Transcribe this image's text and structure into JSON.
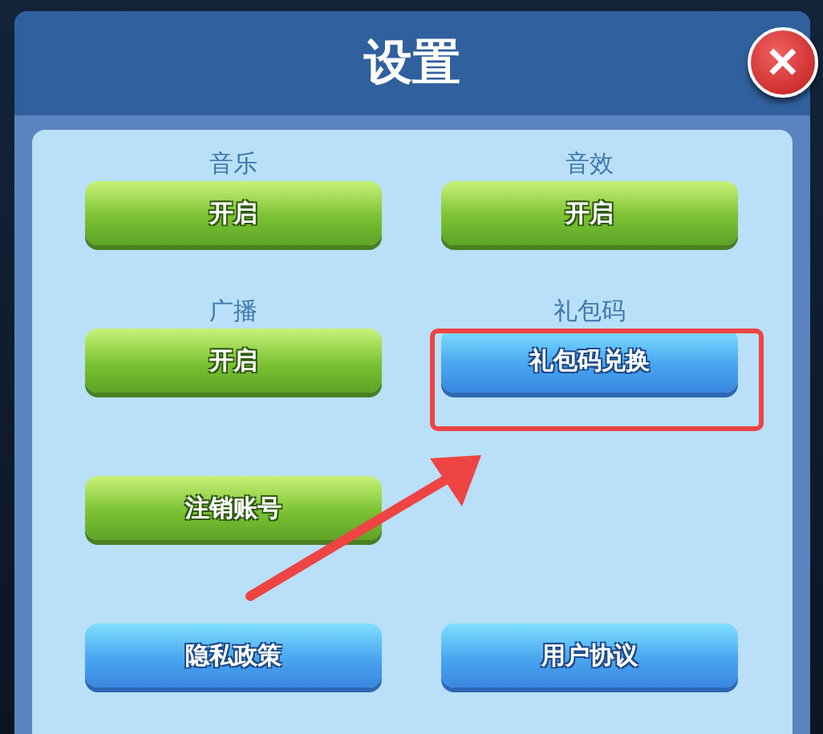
{
  "dialog": {
    "title": "设置",
    "close_button": "✕"
  },
  "rows": [
    [
      {
        "label": "音乐",
        "button": "开启",
        "kind": "green"
      },
      {
        "label": "音效",
        "button": "开启",
        "kind": "green"
      }
    ],
    [
      {
        "label": "广播",
        "button": "开启",
        "kind": "green"
      },
      {
        "label": "礼包码",
        "button": "礼包码兑换",
        "kind": "blue"
      }
    ],
    [
      {
        "button": "注销账号",
        "kind": "green"
      }
    ],
    [
      {
        "button": "隐私政策",
        "kind": "blue"
      },
      {
        "button": "用户协议",
        "kind": "blue"
      }
    ]
  ]
}
